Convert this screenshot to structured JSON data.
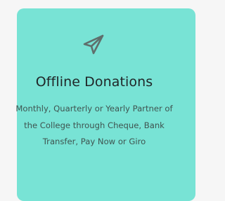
{
  "card": {
    "icon": "paper-plane-icon",
    "title": "Offline Donations",
    "description": "Monthly, Quarterly or Yearly Partner of the College through Cheque, Bank Transfer, Pay Now or Giro",
    "background_color": "#78e3d5",
    "title_color": "#202628",
    "text_color": "#3f5450"
  }
}
